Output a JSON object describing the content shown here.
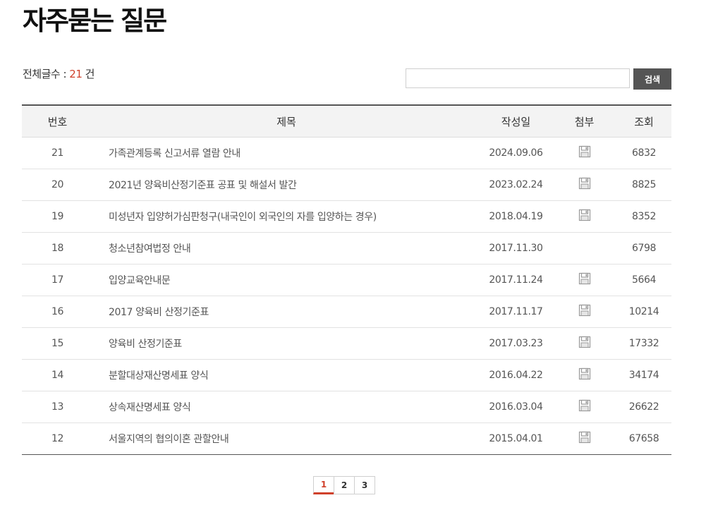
{
  "page": {
    "title": "자주묻는 질문"
  },
  "summary": {
    "label": "전체글수 : ",
    "count": "21",
    "unit": " 건"
  },
  "search": {
    "placeholder": "",
    "button_label": "검색"
  },
  "table": {
    "headers": {
      "no": "번호",
      "title": "제목",
      "date": "작성일",
      "file": "첨부",
      "views": "조회"
    },
    "rows": [
      {
        "no": "21",
        "title": "가족관계등록 신고서류 열람 안내",
        "date": "2024.09.06",
        "has_file": true,
        "views": "6832"
      },
      {
        "no": "20",
        "title": "2021년 양육비산정기준표 공표 및 해설서 발간",
        "date": "2023.02.24",
        "has_file": true,
        "views": "8825"
      },
      {
        "no": "19",
        "title": "미성년자 입양허가심판청구(내국인이 외국인의 자를 입양하는 경우)",
        "date": "2018.04.19",
        "has_file": true,
        "views": "8352"
      },
      {
        "no": "18",
        "title": "청소년참여법정 안내",
        "date": "2017.11.30",
        "has_file": false,
        "views": "6798"
      },
      {
        "no": "17",
        "title": "입양교육안내문",
        "date": "2017.11.24",
        "has_file": true,
        "views": "5664"
      },
      {
        "no": "16",
        "title": "2017 양육비 산정기준표",
        "date": "2017.11.17",
        "has_file": true,
        "views": "10214"
      },
      {
        "no": "15",
        "title": "양육비 산정기준표",
        "date": "2017.03.23",
        "has_file": true,
        "views": "17332"
      },
      {
        "no": "14",
        "title": "분할대상재산명세표 양식",
        "date": "2016.04.22",
        "has_file": true,
        "views": "34174"
      },
      {
        "no": "13",
        "title": "상속재산명세표 양식",
        "date": "2016.03.04",
        "has_file": true,
        "views": "26622"
      },
      {
        "no": "12",
        "title": "서울지역의 협의이혼 관할안내",
        "date": "2015.04.01",
        "has_file": true,
        "views": "67658"
      }
    ]
  },
  "pagination": {
    "pages": [
      "1",
      "2",
      "3"
    ],
    "current": "1"
  },
  "icons": {
    "attachment": "file-attachment-icon"
  },
  "colors": {
    "accent": "#d0412b",
    "search_button": "#555555"
  }
}
